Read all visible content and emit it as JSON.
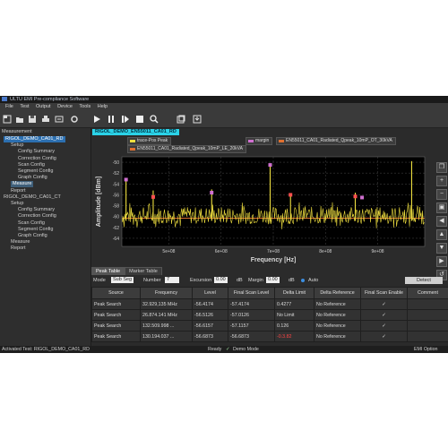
{
  "window": {
    "title": "ULTU EMI Pre-compliance Software"
  },
  "menu": [
    "File",
    "Test",
    "Output",
    "Device",
    "Tools",
    "Help"
  ],
  "tree": {
    "header": "Measurement",
    "nodes": [
      {
        "label": "RIGOL_DEMO_CA01_RD",
        "level": 0,
        "state": "sel"
      },
      {
        "label": "Setup",
        "level": 1,
        "state": ""
      },
      {
        "label": "Config Summary",
        "level": 2,
        "state": ""
      },
      {
        "label": "Correction Config",
        "level": 2,
        "state": ""
      },
      {
        "label": "Scan Config",
        "level": 2,
        "state": ""
      },
      {
        "label": "Segment Config",
        "level": 2,
        "state": ""
      },
      {
        "label": "Graph Config",
        "level": 2,
        "state": ""
      },
      {
        "label": "Measure",
        "level": 1,
        "state": "hi"
      },
      {
        "label": "Report",
        "level": 1,
        "state": ""
      },
      {
        "label": "RIGOL_DEMO_CA01_CT",
        "level": 0,
        "state": ""
      },
      {
        "label": "Setup",
        "level": 1,
        "state": ""
      },
      {
        "label": "Config Summary",
        "level": 2,
        "state": ""
      },
      {
        "label": "Correction Config",
        "level": 2,
        "state": ""
      },
      {
        "label": "Scan Config",
        "level": 2,
        "state": ""
      },
      {
        "label": "Segment Config",
        "level": 2,
        "state": ""
      },
      {
        "label": "Graph Config",
        "level": 2,
        "state": ""
      },
      {
        "label": "Measure",
        "level": 1,
        "state": ""
      },
      {
        "label": "Report",
        "level": 1,
        "state": ""
      }
    ]
  },
  "main": {
    "test_name": "RIGOL_DEMO_EN55011_CA01_RD",
    "legends": [
      {
        "label": "trace-Pos Peak",
        "color": "#f0e040"
      },
      {
        "label": "margin",
        "color": "#d070d0"
      },
      {
        "label": "EN55011_CA01_Radiated_Qpeak_10mP_OT_30kVA",
        "color": "#e07030"
      },
      {
        "label": "EN55011_CA01_Radiated_Qpeak_10mP_LE_20kVA",
        "color": "#e07030"
      }
    ]
  },
  "chart_data": {
    "type": "line",
    "title": "",
    "xlabel": "Frequency [Hz]",
    "ylabel": "Amplitude [dBm]",
    "x_ticks": [
      "5e+08",
      "6e+08",
      "7e+08",
      "8e+08",
      "9e+08"
    ],
    "x_tick_values": [
      500000000,
      600000000,
      700000000,
      800000000,
      900000000
    ],
    "xlim": [
      410000000,
      990000000
    ],
    "y_ticks": [
      "-50",
      "-52",
      "-54",
      "-56",
      "-58",
      "-60",
      "-62",
      "-64"
    ],
    "ylim": [
      -65.5,
      -49
    ],
    "grid": true,
    "series": [
      {
        "name": "trace-Pos Peak",
        "color": "#f0e040",
        "baseline": -59.8,
        "spread": 1.6
      },
      {
        "name": "EN55011_CA01_Radiated_Qpeak_10mP_OT_30kVA",
        "color": "#e07030",
        "values_const": -60.3
      }
    ],
    "spikes": [
      {
        "x": 418000000,
        "y": -53.0
      },
      {
        "x": 470000000,
        "y": -55.2
      },
      {
        "x": 582000000,
        "y": -55.0
      },
      {
        "x": 694000000,
        "y": -50.3
      },
      {
        "x": 733000000,
        "y": -55.8
      },
      {
        "x": 857000000,
        "y": -55.6
      },
      {
        "x": 965000000,
        "y": -49.8
      }
    ],
    "markers": [
      {
        "x": 418000000,
        "y": -53.2,
        "color": "#d070d0"
      },
      {
        "x": 470000000,
        "y": -56.4,
        "color": "#ff5050"
      },
      {
        "x": 582000000,
        "y": -55.6,
        "color": "#d070d0"
      },
      {
        "x": 694000000,
        "y": -50.5,
        "color": "#d070d0"
      },
      {
        "x": 733000000,
        "y": -56.0,
        "color": "#ff5050"
      },
      {
        "x": 857000000,
        "y": -56.3,
        "color": "#ff5050"
      },
      {
        "x": 870000000,
        "y": -56.5,
        "color": "#d070d0"
      }
    ]
  },
  "tabs": [
    {
      "label": "Peak Table",
      "active": true
    },
    {
      "label": "Marker Table",
      "active": false
    }
  ],
  "controls": {
    "mode_label": "Mode",
    "mode_value": "Sub Seg",
    "number_label": "Number",
    "number_value": "7",
    "excursion_label": "Excursion",
    "excursion_value": "0.00",
    "excursion_unit": "dB",
    "margin_label": "Margin",
    "margin_value": "0.00",
    "margin_unit": "dB",
    "auto_label": "Auto",
    "detect_label": "Detect"
  },
  "table": {
    "columns": [
      "Source",
      "Frequency",
      "Level",
      "Final Scan Level",
      "Delta Limit",
      "Delta Reference",
      "Final Scan Enable",
      "Comment"
    ],
    "rows": [
      [
        "Peak Search",
        "32.929,135 MHz",
        "-56.4174",
        "-57.4174",
        "0.4277",
        "No Reference",
        "✓",
        ""
      ],
      [
        "Peak Search",
        "26.874.141 MHz",
        "-56.5126",
        "-57.0126",
        "No Limit",
        "No Reference",
        "✓",
        ""
      ],
      [
        "Peak Search",
        "132.509.998 ...",
        "-56.6157",
        "-57.1157",
        "0.126",
        "No Reference",
        "✓",
        ""
      ],
      [
        "Peak Search",
        "130.194.037 ...",
        "-56.6873",
        "-56.6873",
        "-0.3.82",
        "No Reference",
        "✓",
        ""
      ]
    ]
  },
  "status": {
    "activated": "Activated Test:  RIGOL_DEMO_CA01_RD",
    "ready": "Ready",
    "demo": "Demo Mode",
    "option": "EMI Option"
  }
}
